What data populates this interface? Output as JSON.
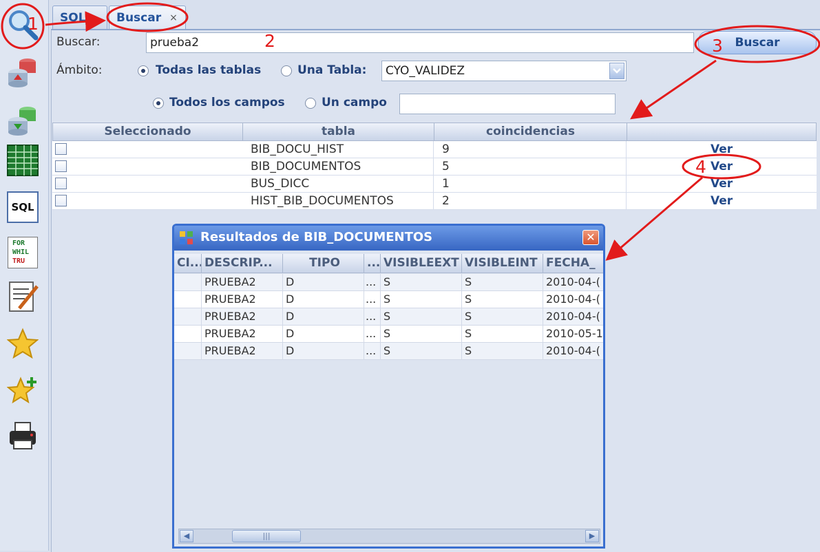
{
  "tabs": [
    {
      "label": "SQL",
      "active": false
    },
    {
      "label": "Buscar",
      "active": true,
      "close": "×"
    }
  ],
  "sidebar": {
    "icons": [
      "search-icon",
      "export-db-icon",
      "import-db-icon",
      "spreadsheet-icon",
      "sql-icon",
      "script-loop-icon",
      "edit-note-icon",
      "favorite-star-icon",
      "add-favorite-icon",
      "printer-icon"
    ],
    "sql_label": "SQL",
    "script_labels": [
      "FOR",
      "WHIL",
      "TRU"
    ]
  },
  "search": {
    "label": "Buscar:",
    "value": "prueba2",
    "button": "Buscar"
  },
  "scope": {
    "label": "Ámbito:",
    "all_tables": "Todas las tablas",
    "one_table": "Una Tabla:",
    "table_value": "CYO_VALIDEZ",
    "all_fields": "Todos los campos",
    "one_field": "Un campo",
    "field_value": ""
  },
  "results_table": {
    "columns": [
      "Seleccionado",
      "tabla",
      "coincidencias",
      ""
    ],
    "rows": [
      {
        "tabla": "BIB_DOCU_HIST",
        "coincidencias": "9",
        "action": "Ver"
      },
      {
        "tabla": "BIB_DOCUMENTOS",
        "coincidencias": "5",
        "action": "Ver"
      },
      {
        "tabla": "BUS_DICC",
        "coincidencias": "1",
        "action": "Ver"
      },
      {
        "tabla": "HIST_BIB_DOCUMENTOS",
        "coincidencias": "2",
        "action": "Ver"
      }
    ]
  },
  "result_window": {
    "title": "Resultados de BIB_DOCUMENTOS",
    "close": "✕",
    "columns": [
      "CI...",
      "DESCRIP...",
      "TIPO",
      "...",
      "VISIBLEEXT",
      "VISIBLEINT",
      "FECHA_"
    ],
    "rows": [
      [
        "",
        "PRUEBA2",
        "D",
        "...",
        "S",
        "S",
        "2010-04-("
      ],
      [
        "",
        "PRUEBA2",
        "D",
        "...",
        "S",
        "S",
        "2010-04-("
      ],
      [
        "",
        "PRUEBA2",
        "D",
        "...",
        "S",
        "S",
        "2010-04-("
      ],
      [
        "",
        "PRUEBA2",
        "D",
        "...",
        "S",
        "S",
        "2010-05-1"
      ],
      [
        "",
        "PRUEBA2",
        "D",
        "...",
        "S",
        "S",
        "2010-04-("
      ]
    ],
    "scroll_left": "◀",
    "scroll_right": "▶",
    "thumb_grip": "|||"
  },
  "annotations": [
    "1",
    "2",
    "3",
    "4"
  ],
  "colors": {
    "accent": "#24539b",
    "annotation": "#e21b1b",
    "window_title": "#3766c3"
  }
}
